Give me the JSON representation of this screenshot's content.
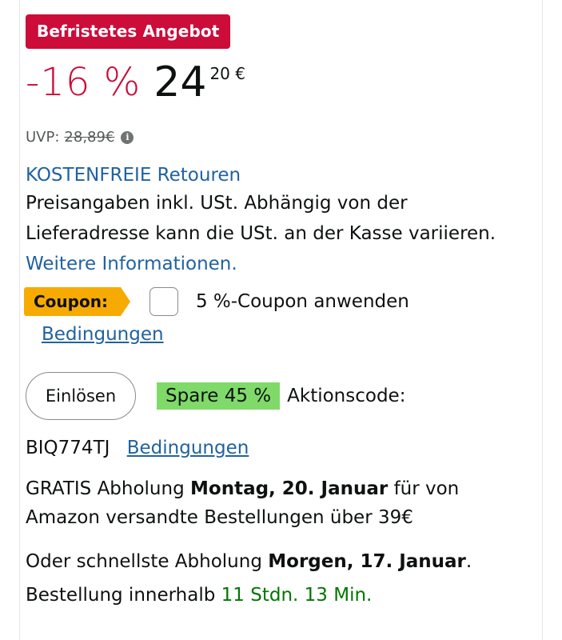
{
  "deal_badge": "Befristetes Angebot",
  "price": {
    "discount": "-16 %",
    "whole": "24",
    "fraction": "20 €"
  },
  "uvp": {
    "label": "UVP:",
    "value": "28,89€"
  },
  "returns_link": "KOSTENFREIE Retouren",
  "tax": {
    "text": "Preisangaben inkl. USt. Abhängig von der Lieferadresse kann die USt. an der Kasse variieren.",
    "more_link": "Weitere Informationen."
  },
  "coupon": {
    "tag": "Coupon:",
    "label": "5 %-Coupon anwenden",
    "terms_link": "Bedingungen",
    "checked": false
  },
  "promo": {
    "button": "Einlösen",
    "save_badge": "Spare 45 %",
    "label": "Aktionscode:",
    "code": "BIQ774TJ",
    "terms_link": "Bedingungen"
  },
  "delivery": {
    "prefix": "GRATIS Abholung",
    "date": "Montag, 20. Januar",
    "suffix": "für von Amazon versandte Bestellungen über 39€"
  },
  "fast_delivery": {
    "prefix": "Oder schnellste Abholung",
    "date": "Morgen, 17. Januar",
    "middle": ". Bestellung innerhalb",
    "countdown": "11 Stdn. 13 Min."
  },
  "colors": {
    "deal_red": "#cc0c39",
    "link_blue": "#2162a1",
    "coupon_orange": "#f7ab02",
    "save_green": "#7fda69",
    "countdown_green": "#007600"
  }
}
